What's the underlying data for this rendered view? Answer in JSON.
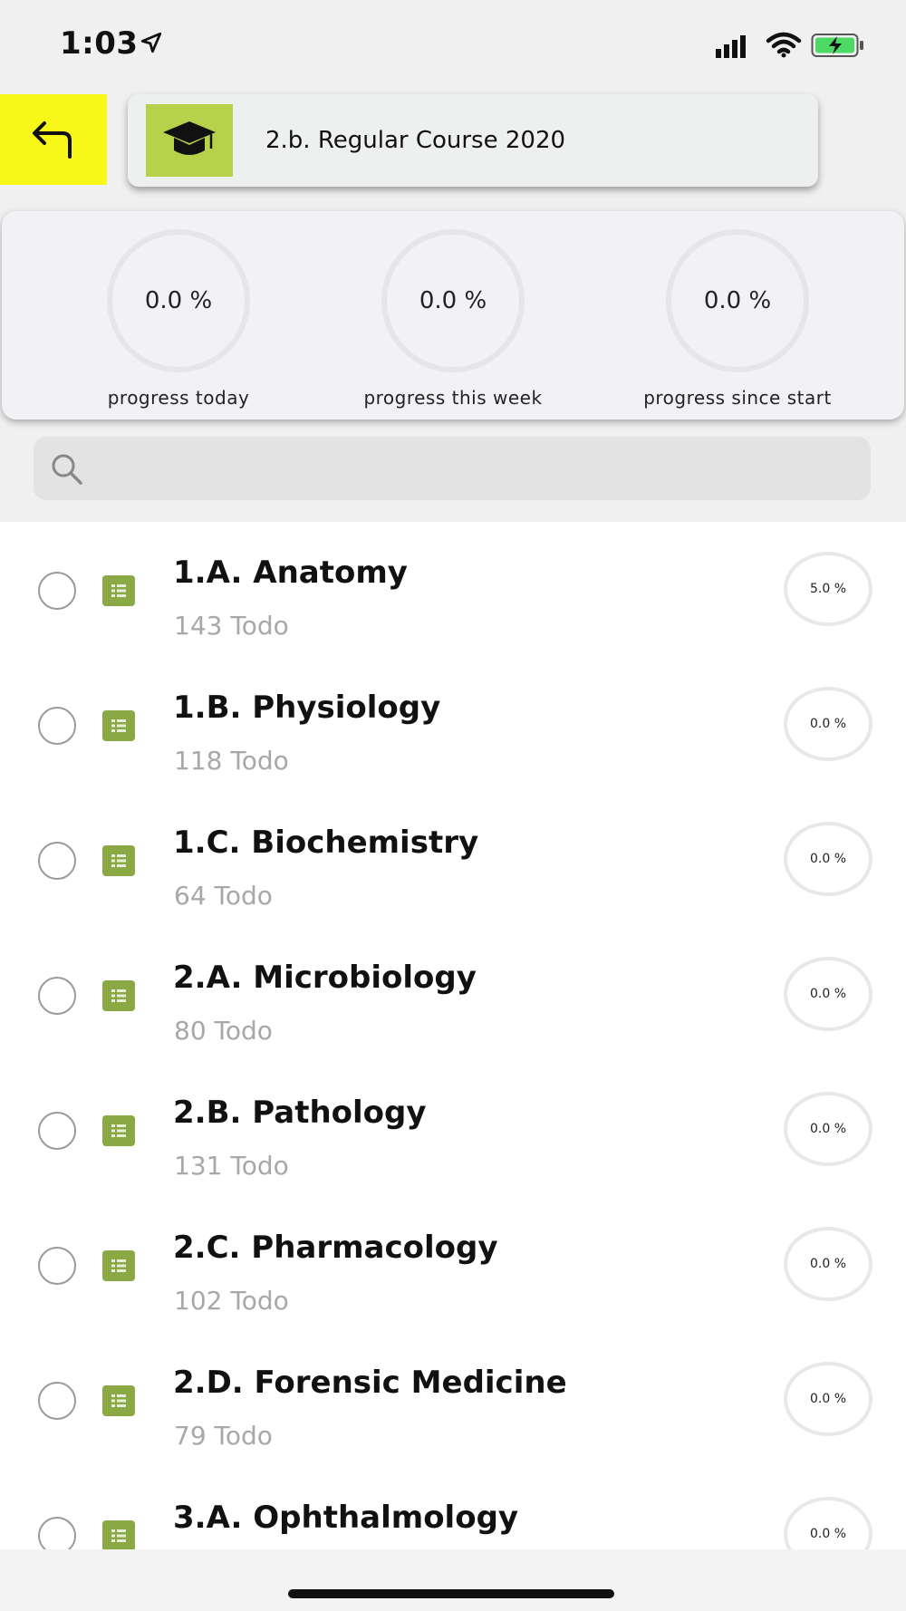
{
  "status_bar": {
    "time": "1:03",
    "location_icon": "location-arrow-icon",
    "signal_icon": "cellular-signal-icon",
    "wifi_icon": "wifi-icon",
    "battery_icon": "battery-charging-icon",
    "battery_color": "#4cd964"
  },
  "header": {
    "back_icon": "back-arrow-icon",
    "back_color": "#f7f71a",
    "course_icon": "graduation-cap-icon",
    "course_icon_bg": "#b6d24a",
    "course_title": "2.b. Regular Course 2020"
  },
  "progress": [
    {
      "value": "0.0 %",
      "label": "progress today"
    },
    {
      "value": "0.0 %",
      "label": "progress this week"
    },
    {
      "value": "0.0 %",
      "label": "progress since start"
    }
  ],
  "search": {
    "icon": "search-icon",
    "placeholder": ""
  },
  "subjects": [
    {
      "title": "1.A. Anatomy",
      "todo": "143 Todo",
      "percent_label": "5.0 %",
      "percent": 5.0
    },
    {
      "title": "1.B. Physiology",
      "todo": "118 Todo",
      "percent_label": "0.0 %",
      "percent": 0.0
    },
    {
      "title": "1.C. Biochemistry",
      "todo": "64 Todo",
      "percent_label": "0.0 %",
      "percent": 0.0
    },
    {
      "title": "2.A. Microbiology",
      "todo": "80 Todo",
      "percent_label": "0.0 %",
      "percent": 0.0
    },
    {
      "title": "2.B. Pathology",
      "todo": "131 Todo",
      "percent_label": "0.0 %",
      "percent": 0.0
    },
    {
      "title": "2.C. Pharmacology",
      "todo": "102 Todo",
      "percent_label": "0.0 %",
      "percent": 0.0
    },
    {
      "title": "2.D. Forensic Medicine",
      "todo": "79 Todo",
      "percent_label": "0.0 %",
      "percent": 0.0
    },
    {
      "title": "3.A. Ophthalmology",
      "todo": "",
      "percent_label": "0.0 %",
      "percent": 0.0
    }
  ],
  "colors": {
    "chip": "#8aa843",
    "ring_track": "#e8e8e8",
    "ring_progress": "#a4c639"
  }
}
